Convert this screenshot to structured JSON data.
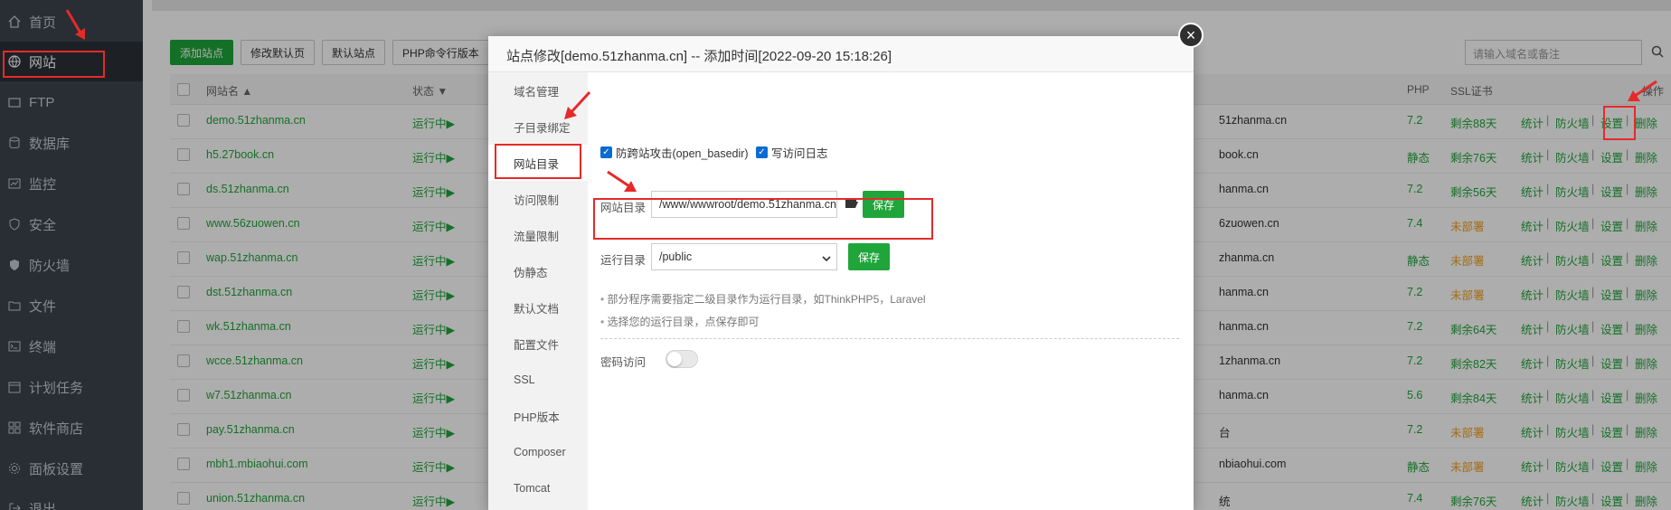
{
  "sidebar": {
    "items": [
      {
        "label": "首页",
        "icon": "home-icon"
      },
      {
        "label": "网站",
        "icon": "globe-icon"
      },
      {
        "label": "FTP",
        "icon": "ftp-icon"
      },
      {
        "label": "数据库",
        "icon": "database-icon"
      },
      {
        "label": "监控",
        "icon": "monitor-icon"
      },
      {
        "label": "安全",
        "icon": "shield-icon"
      },
      {
        "label": "防火墙",
        "icon": "firewall-icon"
      },
      {
        "label": "文件",
        "icon": "folder-icon"
      },
      {
        "label": "终端",
        "icon": "terminal-icon"
      },
      {
        "label": "计划任务",
        "icon": "calendar-icon"
      },
      {
        "label": "软件商店",
        "icon": "apps-icon"
      },
      {
        "label": "面板设置",
        "icon": "gear-icon"
      },
      {
        "label": "退出",
        "icon": "logout-icon"
      }
    ]
  },
  "toolbar": {
    "add_site": "添加站点",
    "edit_default_page": "修改默认页",
    "default_site": "默认站点",
    "php_cli_version": "PHP命令行版本"
  },
  "search": {
    "placeholder": "请输入域名或备注"
  },
  "table": {
    "headers": {
      "name": "网站名 ▲",
      "status": "状态 ▼",
      "php": "PHP",
      "ssl": "SSL证书",
      "ops": "操作"
    },
    "rows": [
      {
        "name": "demo.51zhanma.cn",
        "status": "运行中▶",
        "domain": "51zhanma.cn",
        "php": "7.2",
        "ssl": "剩余88天",
        "ssl_warn": false
      },
      {
        "name": "h5.27book.cn",
        "status": "运行中▶",
        "domain": "book.cn",
        "php": "静态",
        "ssl": "剩余76天",
        "ssl_warn": false
      },
      {
        "name": "ds.51zhanma.cn",
        "status": "运行中▶",
        "domain": "hanma.cn",
        "php": "7.2",
        "ssl": "剩余56天",
        "ssl_warn": false
      },
      {
        "name": "www.56zuowen.cn",
        "status": "运行中▶",
        "domain": "6zuowen.cn",
        "php": "7.4",
        "ssl": "未部署",
        "ssl_warn": true
      },
      {
        "name": "wap.51zhanma.cn",
        "status": "运行中▶",
        "domain": "zhanma.cn",
        "php": "静态",
        "ssl": "未部署",
        "ssl_warn": true
      },
      {
        "name": "dst.51zhanma.cn",
        "status": "运行中▶",
        "domain": "hanma.cn",
        "php": "7.2",
        "ssl": "未部署",
        "ssl_warn": true
      },
      {
        "name": "wk.51zhanma.cn",
        "status": "运行中▶",
        "domain": "hanma.cn",
        "php": "7.2",
        "ssl": "剩余64天",
        "ssl_warn": false
      },
      {
        "name": "wcce.51zhanma.cn",
        "status": "运行中▶",
        "domain": "1zhanma.cn",
        "php": "7.2",
        "ssl": "剩余82天",
        "ssl_warn": false
      },
      {
        "name": "w7.51zhanma.cn",
        "status": "运行中▶",
        "domain": "hanma.cn",
        "php": "5.6",
        "ssl": "剩余84天",
        "ssl_warn": false
      },
      {
        "name": "pay.51zhanma.cn",
        "status": "运行中▶",
        "domain": "台",
        "php": "7.2",
        "ssl": "未部署",
        "ssl_warn": true
      },
      {
        "name": "mbh1.mbiaohui.com",
        "status": "运行中▶",
        "domain": "nbiaohui.com",
        "php": "静态",
        "ssl": "未部署",
        "ssl_warn": true
      },
      {
        "name": "union.51zhanma.cn",
        "status": "运行中▶",
        "domain": "统",
        "php": "7.4",
        "ssl": "剩余76天",
        "ssl_warn": false
      }
    ],
    "ops": {
      "stats": "统计",
      "firewall": "防火墙",
      "settings": "设置",
      "delete": "删除",
      "sep": "|"
    }
  },
  "modal": {
    "title": "站点修改[demo.51zhanma.cn] -- 添加时间[2022-09-20 15:18:26]",
    "close": "×",
    "menu": [
      "域名管理",
      "子目录绑定",
      "网站目录",
      "访问限制",
      "流量限制",
      "伪静态",
      "默认文档",
      "配置文件",
      "SSL",
      "PHP版本",
      "Composer",
      "Tomcat"
    ],
    "anti_xss": "防跨站攻击(open_basedir)",
    "write_log": "写访问日志",
    "site_dir_label": "网站目录",
    "site_dir_value": "/www/wwwroot/demo.51zhanma.cn",
    "run_dir_label": "运行目录",
    "run_dir_value": "/public",
    "save": "保存",
    "tip1": "部分程序需要指定二级目录作为运行目录，如ThinkPHP5，Laravel",
    "tip2": "选择您的运行目录，点保存即可",
    "password_access": "密码访问"
  },
  "colors": {
    "accent": "#20a53a",
    "highlight": "#e52a2a",
    "sidebar": "#3c444d"
  }
}
